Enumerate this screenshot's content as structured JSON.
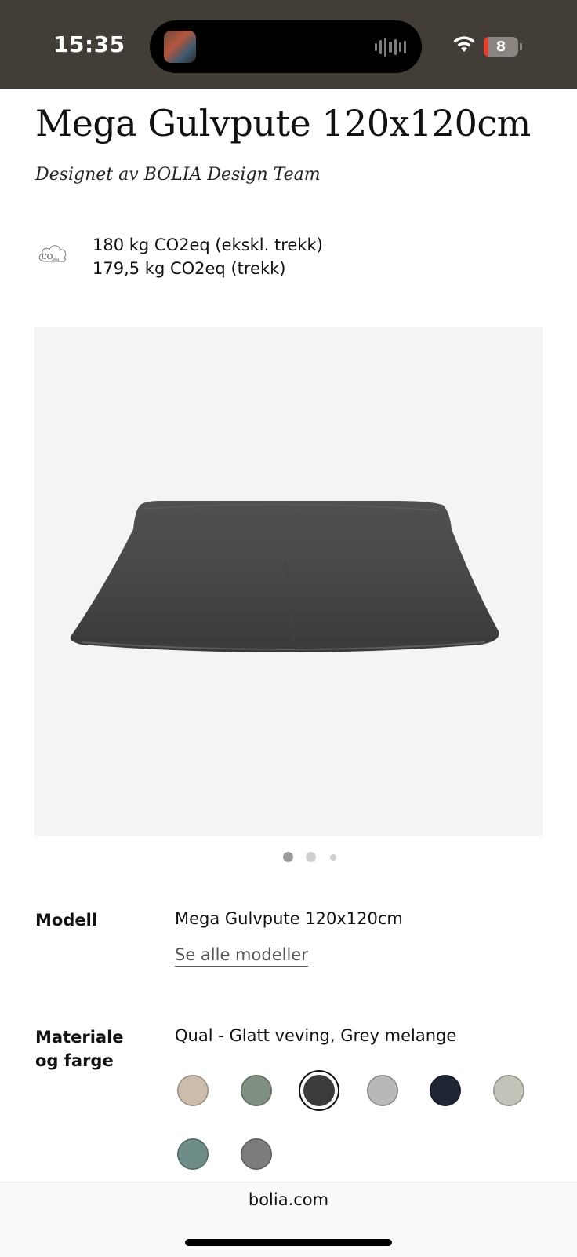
{
  "status_bar": {
    "time": "15:35",
    "battery_level": "8",
    "colors": {
      "background": "#433d38",
      "battery_low": "#e0402e"
    }
  },
  "product": {
    "title": "Mega Gulvpute 120x120cm",
    "designer": "Designet av BOLIA Design Team",
    "co2": {
      "icon": "cloud-co2-icon",
      "icon_text": "CO",
      "icon_sub": "2eq",
      "line1": "180 kg CO2eq (ekskl. trekk)",
      "line2": "179,5 kg CO2eq (trekk)"
    },
    "image": {
      "description_icon": "floor-cushion-image",
      "carousel_index": 1,
      "carousel_total": 3
    }
  },
  "model": {
    "label": "Modell",
    "value": "Mega Gulvpute 120x120cm",
    "link": "Se alle modeller"
  },
  "material": {
    "label_line1": "Materiale",
    "label_line2": "og farge",
    "value": "Qual - Glatt veving, Grey melange",
    "swatches": [
      {
        "color": "#cbbcab"
      },
      {
        "color": "#7f8f81"
      },
      {
        "color": "#3b3b3b",
        "selected": true
      },
      {
        "color": "#b8b8b6"
      },
      {
        "color": "#1e2535"
      },
      {
        "color": "#c4c3b9"
      },
      {
        "color": "#6e8c88"
      },
      {
        "color": "#7c7b7d"
      }
    ]
  },
  "browser": {
    "url": "bolia.com"
  }
}
